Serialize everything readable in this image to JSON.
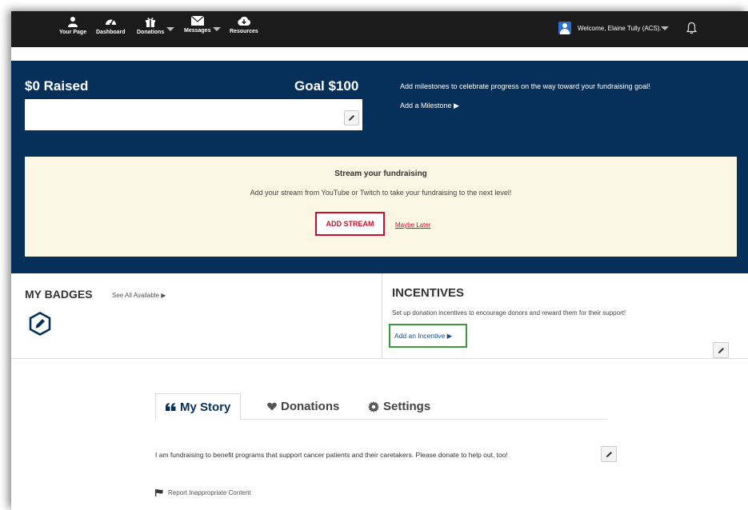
{
  "nav": {
    "items": [
      {
        "label": "Your Page",
        "icon": "user-icon"
      },
      {
        "label": "Dashboard",
        "icon": "dashboard-icon"
      },
      {
        "label": "Donations",
        "icon": "gift-icon"
      },
      {
        "label": "Messages",
        "icon": "envelope-icon"
      },
      {
        "label": "Resources",
        "icon": "cloud-download-icon"
      }
    ],
    "welcome": "Welcome, Elaine Tully (ACS)."
  },
  "fundraising": {
    "raised": "$0 Raised",
    "goal": "Goal $100",
    "progress_fraction": 0,
    "milestone_text": "Add milestones to celebrate progress on the way toward your fundraising goal!",
    "milestone_link": "Add a Milestone ▶"
  },
  "stream": {
    "title": "Stream your fundraising",
    "description": "Add your stream from YouTube or Twitch to take your fundraising to the next level!",
    "add_button": "ADD STREAM",
    "later_link": "Maybe Later"
  },
  "badges": {
    "title": "MY BADGES",
    "see_all": "See All Available ▶"
  },
  "incentives": {
    "title": "INCENTIVES",
    "description": "Set up donation incentives to encourage donors and reward them for their support!",
    "add_link": "Add an Incentive ▶"
  },
  "tabs": [
    {
      "label": "My Story",
      "icon": "quote-icon",
      "active": true
    },
    {
      "label": "Donations",
      "icon": "heart-icon",
      "active": false
    },
    {
      "label": "Settings",
      "icon": "gear-icon",
      "active": false
    }
  ],
  "story_text": "I am fundraising to benefit programs that support cancer patients and their caretakers. Please donate to help out, too!",
  "report_link": "Report Inappropriate Content",
  "colors": {
    "navy": "#06305a",
    "accent_red": "#c8102e",
    "highlight_green": "#3a9c3a",
    "stream_bg": "#fcf6e4"
  }
}
